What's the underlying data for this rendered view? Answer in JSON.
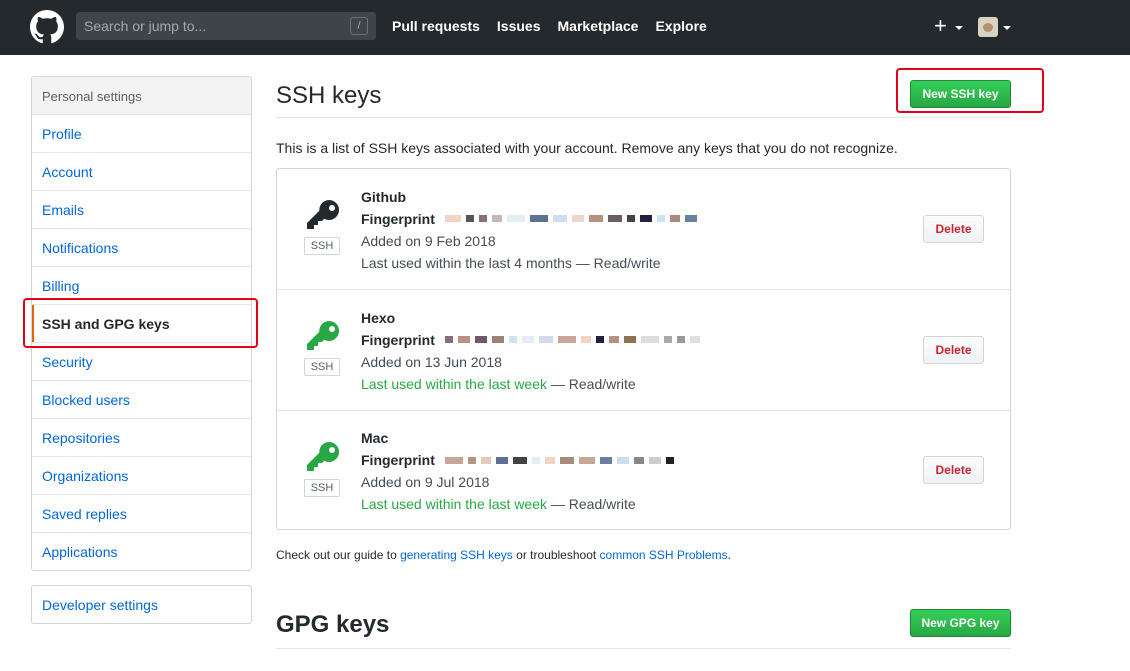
{
  "header": {
    "search_placeholder": "Search or jump to...",
    "search_shortcut": "/",
    "nav": [
      "Pull requests",
      "Issues",
      "Marketplace",
      "Explore"
    ],
    "new_menu": "+"
  },
  "sidebar": {
    "heading": "Personal settings",
    "items": [
      {
        "label": "Profile"
      },
      {
        "label": "Account"
      },
      {
        "label": "Emails"
      },
      {
        "label": "Notifications"
      },
      {
        "label": "Billing"
      },
      {
        "label": "SSH and GPG keys",
        "selected": true
      },
      {
        "label": "Security"
      },
      {
        "label": "Blocked users"
      },
      {
        "label": "Repositories"
      },
      {
        "label": "Organizations"
      },
      {
        "label": "Saved replies"
      },
      {
        "label": "Applications"
      }
    ],
    "developer": "Developer settings"
  },
  "ssh": {
    "title": "SSH keys",
    "new_button": "New SSH key",
    "intro": "This is a list of SSH keys associated with your account. Remove any keys that you do not recognize.",
    "keys": [
      {
        "name": "Github",
        "fingerprint_label": "Fingerprint",
        "added": "Added on 9 Feb 2018",
        "used_recent": "",
        "used_rest": "Last used within the last 4 months — Read/write",
        "badge": "SSH",
        "delete": "Delete",
        "icon_color": "#24292e"
      },
      {
        "name": "Hexo",
        "fingerprint_label": "Fingerprint",
        "added": "Added on 13 Jun 2018",
        "used_recent": "Last used within the last week",
        "used_rest": " — Read/write",
        "badge": "SSH",
        "delete": "Delete",
        "icon_color": "#28a745"
      },
      {
        "name": "Mac",
        "fingerprint_label": "Fingerprint",
        "added": "Added on 9 Jul 2018",
        "used_recent": "Last used within the last week",
        "used_rest": " — Read/write",
        "badge": "SSH",
        "delete": "Delete",
        "icon_color": "#28a745"
      }
    ],
    "guide_prefix": "Check out our guide to ",
    "guide_link1": "generating SSH keys",
    "guide_middle": " or troubleshoot ",
    "guide_link2": "common SSH Problems",
    "guide_suffix": "."
  },
  "gpg": {
    "title": "GPG keys",
    "new_button": "New GPG key"
  },
  "colors": {
    "header_bg": "#24292e",
    "link": "#0366d6",
    "primary": "#28a745",
    "danger": "#cb2431",
    "selected_accent": "#e36209",
    "highlight_box": "#e3001b"
  }
}
